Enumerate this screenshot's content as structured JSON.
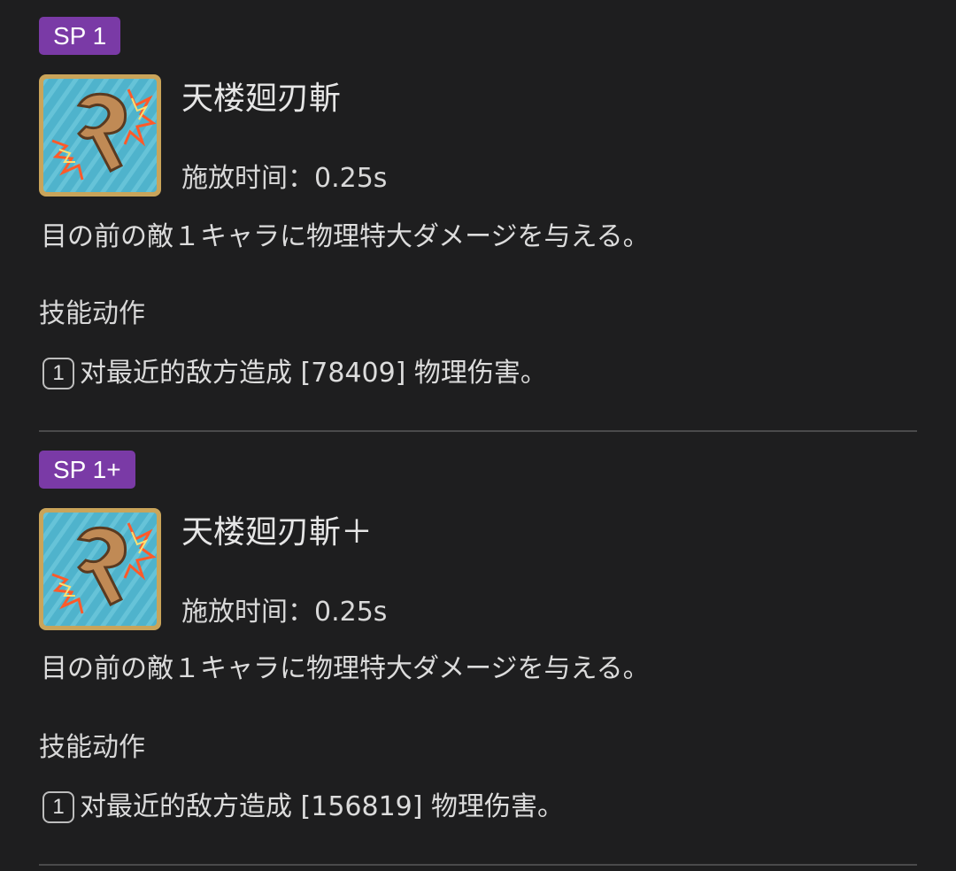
{
  "skills": [
    {
      "sp_badge": "SP 1",
      "name": "天楼廻刃斬",
      "cast_time": "施放时间：0.25s",
      "description": "目の前の敵１キャラに物理特大ダメージを与える。",
      "actions_heading": "技能动作",
      "action_number": "1",
      "action_text": "对最近的敌方造成 [78409] 物理伤害。"
    },
    {
      "sp_badge": "SP 1+",
      "name": "天楼廻刃斬＋",
      "cast_time": "施放时间：0.25s",
      "description": "目の前の敵１キャラに物理特大ダメージを与える。",
      "actions_heading": "技能动作",
      "action_number": "1",
      "action_text": "对最近的敌方造成 [156819] 物理伤害。"
    }
  ],
  "icons": {
    "skill": "boomerang-slash-icon"
  },
  "colors": {
    "background": "#1e1e1f",
    "badge": "#7a3aa6",
    "icon_frame": "#c9a45a",
    "icon_bg": "#4fb3cc"
  }
}
